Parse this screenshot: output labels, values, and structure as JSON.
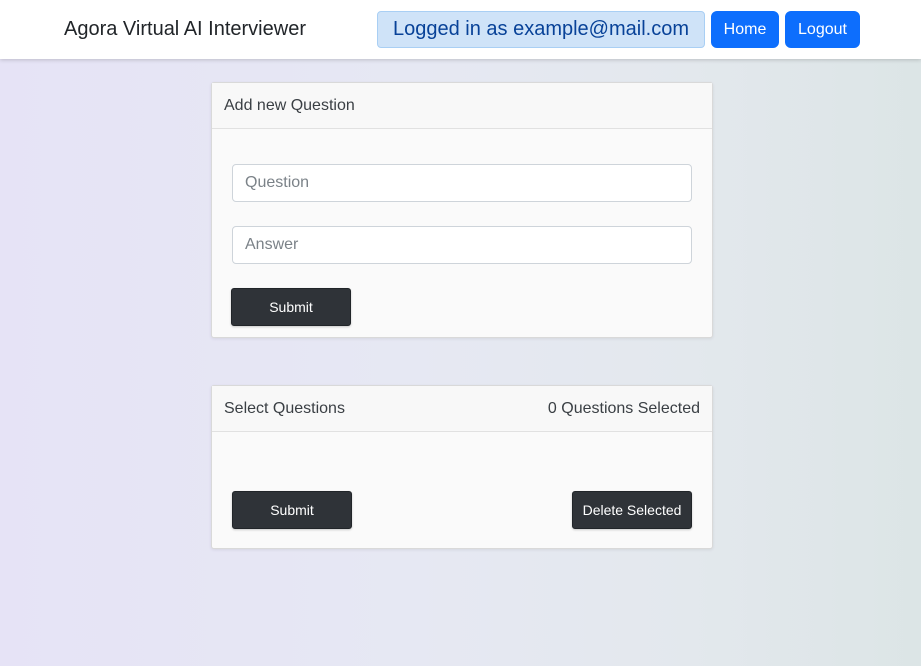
{
  "navbar": {
    "brand": "Agora Virtual AI Interviewer",
    "login_status": "Logged in as example@mail.com",
    "home_label": "Home",
    "logout_label": "Logout"
  },
  "add_question": {
    "title": "Add new Question",
    "question_placeholder": "Question",
    "answer_placeholder": "Answer",
    "submit_label": "Submit"
  },
  "select_questions": {
    "title": "Select Questions",
    "selected_count": "0 Questions Selected",
    "submit_label": "Submit",
    "delete_label": "Delete Selected"
  },
  "colors": {
    "primary": "#0d6efd",
    "dark_button": "#2f3338",
    "info_badge_bg": "#cfe3f8",
    "info_badge_text": "#084298"
  }
}
